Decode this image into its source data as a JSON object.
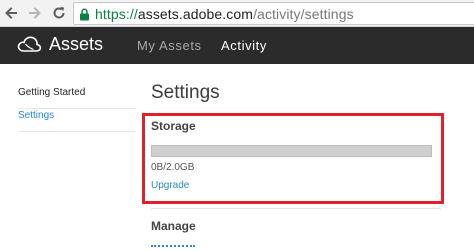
{
  "browser": {
    "url_protocol": "https://",
    "url_host": "assets.adobe.com",
    "url_path": "/activity/settings"
  },
  "header": {
    "app_name": "Assets",
    "nav": [
      {
        "label": "My Assets",
        "active": false
      },
      {
        "label": "Activity",
        "active": true
      }
    ],
    "background_color": "#2b2b2b"
  },
  "sidebar": {
    "items": [
      {
        "label": "Getting Started",
        "active": false
      },
      {
        "label": "Settings",
        "active": true
      }
    ]
  },
  "main": {
    "title": "Settings",
    "storage": {
      "heading": "Storage",
      "used_fraction": 0,
      "usage_text": "0B/2.0GB",
      "upgrade_label": "Upgrade"
    },
    "manage": {
      "heading": "Manage"
    }
  },
  "colors": {
    "link": "#2a88d6",
    "highlight": "#e0202a"
  }
}
